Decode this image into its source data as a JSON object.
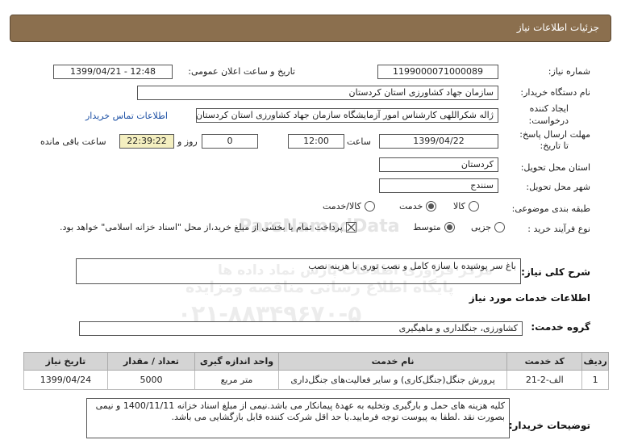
{
  "header": {
    "title": "جزئیات اطلاعات نیاز"
  },
  "watermark": {
    "line1": "ParsNamadData",
    "line2": "مرکز فراوری اطلاعات پارس نماد داده ها",
    "line3": "پایگاه اطلاع رسانی مناقصه ومزایده",
    "line4": "۰۲۱-۸۸۳۴۹۶۷۰-۵"
  },
  "fields": {
    "need_number_label": "شماره نیاز:",
    "need_number": "1199000071000089",
    "announce_label": "تاریخ و ساعت اعلان عمومی:",
    "announce_value": "1399/04/21 - 12:48",
    "buyer_label": "نام دستگاه خریدار:",
    "buyer_value": "سازمان جهاد کشاورزی استان کردستان",
    "creator_label_1": "ایجاد کننده",
    "creator_label_2": "درخواست:",
    "creator_value": "ژاله شکراللهی کارشناس امور آزمایشگاه سازمان جهاد کشاورزی استان کردستان",
    "contact_link": "اطلاعات تماس خریدار",
    "deadline_label_1": "مهلت ارسال پاسخ:",
    "deadline_label_2": "تا تاریخ:",
    "deadline_date": "1399/04/22",
    "time_label": "ساعت",
    "deadline_time": "12:00",
    "days_value": "0",
    "days_label": "روز و",
    "remaining_time": "22:39:22",
    "remaining_label": "ساعت باقی مانده",
    "province_label": "استان محل تحویل:",
    "province_value": "کردستان",
    "city_label": "شهر محل تحویل:",
    "city_value": "سنندج",
    "category_label": "طبقه بندی موضوعی:",
    "category_options": [
      "کالا",
      "خدمت",
      "کالا/خدمت"
    ],
    "category_selected": "خدمت",
    "process_label": "نوع فرآیند خرید :",
    "process_options": [
      "جزیی",
      "متوسط"
    ],
    "process_selected": "متوسط",
    "payment_note": "پرداخت تمام یا بخشی از مبلغ خرید،از محل \"اسناد خزانه اسلامی\" خواهد بود."
  },
  "summary": {
    "label": "شرح کلی نیاز:",
    "value": "باغ سر پوشیده با سازه کامل و نصب توری با هزینه نصب"
  },
  "services_info": {
    "title": "اطلاعات خدمات مورد نیاز"
  },
  "service_group": {
    "label": "گروه خدمت:",
    "value": "کشاورزی، جنگلداری و ماهیگیری"
  },
  "table": {
    "headers": [
      "ردیف",
      "کد خدمت",
      "نام خدمت",
      "واحد اندازه گیری",
      "تعداد / مقدار",
      "تاریخ نیاز"
    ],
    "rows": [
      [
        "1",
        "الف-2-21",
        "پرورش جنگل(جنگل‌کاری) و سایر فعالیت‌های جنگل‌داری",
        "متر مربع",
        "5000",
        "1399/04/24"
      ]
    ]
  },
  "buyer_notes": {
    "label": "توضیحات خریدار:",
    "text": "کلیه هزینه های حمل و بارگیری وتخلیه به عهدۀ پیمانکار می باشد.نیمی از مبلغ اسناد خزانه 1400/11/11 و نیمی بصورت نقد .لطفا به پیوست توجه فرمایید.با حد اقل شرکت کننده قابل بازگشایی می باشد."
  }
}
